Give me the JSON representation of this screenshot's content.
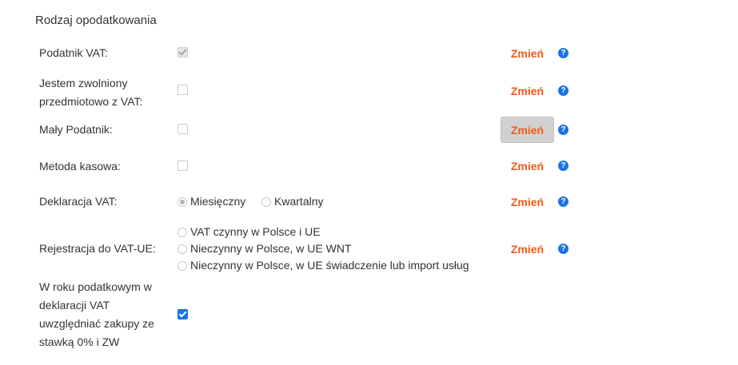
{
  "section": {
    "title": "Rodzaj opodatkowania"
  },
  "rows": {
    "vat_taxpayer": {
      "label": "Podatnik VAT:",
      "action": "Zmień",
      "help": "?"
    },
    "vat_exempt": {
      "label": "Jestem zwolniony przedmiotowo z VAT:",
      "action": "Zmień",
      "help": "?"
    },
    "small_taxpayer": {
      "label": "Mały Podatnik:",
      "action": "Zmień",
      "help": "?"
    },
    "cash_method": {
      "label": "Metoda kasowa:",
      "action": "Zmień",
      "help": "?"
    },
    "vat_declaration": {
      "label": "Deklaracja VAT:",
      "options": [
        "Miesięczny",
        "Kwartalny"
      ],
      "selected": "Miesięczny",
      "action": "Zmień",
      "help": "?"
    },
    "vat_eu": {
      "label": "Rejestracja do VAT-UE:",
      "options": [
        "VAT czynny w Polsce i UE",
        "Nieczynny w Polsce, w UE WNT",
        "Nieczynny w Polsce, w UE świadczenie lub import usług"
      ],
      "action": "Zmień",
      "help": "?"
    },
    "zero_rate_purchases": {
      "label": "W roku podatkowym w deklaracji VAT uwzględniać zakupy ze stawką 0% i ZW",
      "checked": true
    }
  },
  "colors": {
    "accent": "#f05a1a",
    "help": "#1a73e8",
    "checked": "#1a73e8"
  }
}
